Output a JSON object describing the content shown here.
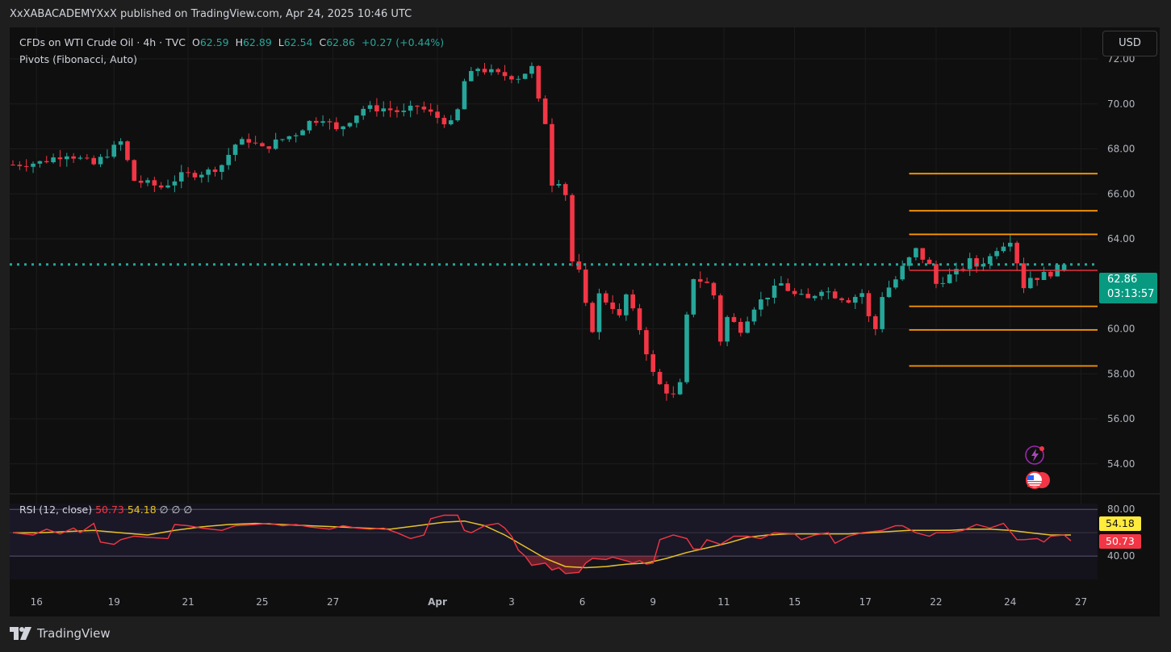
{
  "publication": "XxXABACADEMYXxX published on TradingView.com, Apr 24, 2025 10:46 UTC",
  "legend": {
    "symbol": "CFDs on WTI Crude Oil · 4h · TVC",
    "open_label": "O",
    "open": "62.59",
    "high_label": "H",
    "high": "62.89",
    "low_label": "L",
    "low": "62.54",
    "close_label": "C",
    "close": "62.86",
    "change": "+0.27 (+0.44%)",
    "indicator": "Pivots (Fibonacci, Auto)"
  },
  "currency_button": "USD",
  "last_price": "62.86",
  "countdown": "03:13:57",
  "rsi_legend": {
    "label": "RSI (12, close)",
    "value": "50.73",
    "ma_value": "54.18",
    "extras": "∅  ∅  ∅"
  },
  "rsi_tags": {
    "ma": "54.18",
    "rsi": "50.73"
  },
  "footer": {
    "brand": "TradingView"
  },
  "colors": {
    "up": "#26a69a",
    "down": "#f23645",
    "pivot": "#ff9800",
    "rsi": "#f23645",
    "rsi_ma": "#e6c229",
    "last_price_line": "#26a69a"
  },
  "chart_data": {
    "type": "candlestick",
    "ylim": [
      52.7,
      73.4
    ],
    "y_ticks": [
      "72.00",
      "70.00",
      "68.00",
      "66.00",
      "64.00",
      "60.00",
      "58.00",
      "56.00",
      "54.00"
    ],
    "x_ticks": [
      "16",
      "19",
      "21",
      "25",
      "27",
      "Apr",
      "3",
      "6",
      "9",
      "11",
      "15",
      "17",
      "22",
      "24",
      "27"
    ],
    "last_price": 62.86,
    "pivot_levels": [
      66.9,
      65.25,
      64.2,
      62.6,
      61.0,
      59.95,
      58.35
    ],
    "pivot_current": 62.6,
    "close_path": [
      [
        0,
        67.3
      ],
      [
        4,
        67.4
      ],
      [
        8,
        67.8
      ],
      [
        12,
        67.3
      ],
      [
        16,
        68.3
      ],
      [
        18,
        66.6
      ],
      [
        22,
        66.3
      ],
      [
        25,
        66.8
      ],
      [
        29,
        67.0
      ],
      [
        31,
        67.3
      ],
      [
        33,
        68.2
      ],
      [
        35,
        68.4
      ],
      [
        37,
        68.0
      ],
      [
        39,
        68.3
      ],
      [
        42,
        68.7
      ],
      [
        44,
        69.2
      ],
      [
        46,
        69.4
      ],
      [
        48,
        68.8
      ],
      [
        50,
        69.3
      ],
      [
        52,
        69.8
      ],
      [
        55,
        69.8
      ],
      [
        58,
        69.6
      ],
      [
        60,
        69.9
      ],
      [
        63,
        69.4
      ],
      [
        65,
        69.1
      ],
      [
        66,
        69.7
      ],
      [
        67,
        71.0
      ],
      [
        69,
        71.6
      ],
      [
        72,
        71.3
      ],
      [
        75,
        71.2
      ],
      [
        77,
        71.6
      ],
      [
        78,
        70.1
      ],
      [
        79,
        69.2
      ],
      [
        80,
        66.5
      ],
      [
        81,
        66.6
      ],
      [
        82,
        66.0
      ],
      [
        83,
        63.0
      ],
      [
        84,
        62.5
      ],
      [
        85,
        61.0
      ],
      [
        86,
        60.0
      ],
      [
        87,
        61.5
      ],
      [
        89,
        61.0
      ],
      [
        90,
        60.5
      ],
      [
        91,
        61.5
      ],
      [
        93,
        60.0
      ],
      [
        95,
        58.0
      ],
      [
        96,
        57.5
      ],
      [
        98,
        57.0
      ],
      [
        99,
        57.5
      ],
      [
        100,
        60.5
      ],
      [
        101,
        62.3
      ],
      [
        103,
        62.0
      ],
      [
        104,
        61.5
      ],
      [
        105,
        59.5
      ],
      [
        106,
        60.5
      ],
      [
        108,
        60.0
      ],
      [
        110,
        61.0
      ],
      [
        112,
        61.5
      ],
      [
        114,
        62.0
      ],
      [
        116,
        61.5
      ],
      [
        118,
        61.3
      ],
      [
        120,
        61.8
      ],
      [
        122,
        61.5
      ],
      [
        124,
        61.3
      ],
      [
        126,
        61.6
      ],
      [
        127,
        60.5
      ],
      [
        128,
        60.0
      ],
      [
        129,
        61.5
      ],
      [
        131,
        62.2
      ],
      [
        132,
        62.7
      ],
      [
        133,
        63.1
      ],
      [
        134,
        63.5
      ],
      [
        136,
        62.8
      ],
      [
        137,
        62.0
      ],
      [
        138,
        62.2
      ],
      [
        140,
        62.5
      ],
      [
        142,
        63.0
      ],
      [
        143,
        62.8
      ],
      [
        145,
        63.2
      ],
      [
        146,
        63.6
      ],
      [
        148,
        64.0
      ],
      [
        149,
        63.0
      ],
      [
        150,
        61.9
      ],
      [
        151,
        62.3
      ],
      [
        152,
        62.3
      ],
      [
        154,
        62.5
      ],
      [
        156,
        62.86
      ]
    ],
    "rsi_axis_ticks": [
      "80.00",
      "40.00"
    ],
    "rsi_ylim": [
      20,
      85
    ],
    "rsi_upper": 80,
    "rsi_mid": 60,
    "rsi_lower": 40,
    "rsi_series": [
      [
        0,
        60
      ],
      [
        3,
        58
      ],
      [
        5,
        63
      ],
      [
        7,
        59
      ],
      [
        9,
        64
      ],
      [
        10,
        60
      ],
      [
        12,
        68
      ],
      [
        13,
        52
      ],
      [
        15,
        50
      ],
      [
        16,
        54
      ],
      [
        18,
        57
      ],
      [
        20,
        56
      ],
      [
        23,
        55
      ],
      [
        24,
        67
      ],
      [
        26,
        66
      ],
      [
        28,
        64
      ],
      [
        31,
        62
      ],
      [
        33,
        66
      ],
      [
        36,
        67
      ],
      [
        38,
        68
      ],
      [
        40,
        66
      ],
      [
        42,
        67
      ],
      [
        44,
        65
      ],
      [
        47,
        63
      ],
      [
        49,
        66
      ],
      [
        51,
        64
      ],
      [
        53,
        63
      ],
      [
        55,
        64
      ],
      [
        57,
        60
      ],
      [
        59,
        55
      ],
      [
        61,
        58
      ],
      [
        62,
        72
      ],
      [
        64,
        75
      ],
      [
        66,
        75
      ],
      [
        67,
        62
      ],
      [
        68,
        60
      ],
      [
        70,
        66
      ],
      [
        72,
        68
      ],
      [
        73,
        64
      ],
      [
        74,
        57
      ],
      [
        75,
        45
      ],
      [
        76,
        40
      ],
      [
        77,
        32
      ],
      [
        79,
        34
      ],
      [
        80,
        28
      ],
      [
        81,
        30
      ],
      [
        82,
        25
      ],
      [
        84,
        26
      ],
      [
        85,
        34
      ],
      [
        86,
        38
      ],
      [
        88,
        37
      ],
      [
        89,
        39
      ],
      [
        91,
        36
      ],
      [
        92,
        34
      ],
      [
        93,
        36
      ],
      [
        94,
        33
      ],
      [
        95,
        34
      ],
      [
        96,
        54
      ],
      [
        98,
        58
      ],
      [
        100,
        55
      ],
      [
        101,
        46
      ],
      [
        102,
        46
      ],
      [
        103,
        54
      ],
      [
        105,
        50
      ],
      [
        107,
        57
      ],
      [
        109,
        57
      ],
      [
        111,
        55
      ],
      [
        113,
        60
      ],
      [
        116,
        59
      ],
      [
        117,
        54
      ],
      [
        119,
        58
      ],
      [
        121,
        60
      ],
      [
        122,
        51
      ],
      [
        124,
        57
      ],
      [
        126,
        60
      ],
      [
        129,
        62
      ],
      [
        131,
        66
      ],
      [
        132,
        66
      ],
      [
        134,
        60
      ],
      [
        136,
        57
      ],
      [
        137,
        60
      ],
      [
        139,
        60
      ],
      [
        141,
        62
      ],
      [
        143,
        67
      ],
      [
        145,
        64
      ],
      [
        147,
        68
      ],
      [
        149,
        54
      ],
      [
        150,
        54
      ],
      [
        152,
        55
      ],
      [
        153,
        52
      ],
      [
        154,
        57
      ],
      [
        156,
        58
      ],
      [
        157,
        53
      ]
    ],
    "rsi_ma_series": [
      [
        0,
        60
      ],
      [
        4,
        60
      ],
      [
        8,
        61
      ],
      [
        12,
        62
      ],
      [
        16,
        60
      ],
      [
        20,
        58
      ],
      [
        24,
        62
      ],
      [
        28,
        65
      ],
      [
        32,
        67
      ],
      [
        36,
        68
      ],
      [
        40,
        67
      ],
      [
        44,
        66
      ],
      [
        48,
        65
      ],
      [
        52,
        64
      ],
      [
        56,
        63
      ],
      [
        60,
        66
      ],
      [
        64,
        69
      ],
      [
        67,
        70
      ],
      [
        70,
        66
      ],
      [
        73,
        58
      ],
      [
        76,
        48
      ],
      [
        79,
        38
      ],
      [
        82,
        31
      ],
      [
        85,
        30
      ],
      [
        88,
        31
      ],
      [
        91,
        33
      ],
      [
        94,
        34
      ],
      [
        97,
        38
      ],
      [
        100,
        43
      ],
      [
        103,
        47
      ],
      [
        106,
        51
      ],
      [
        109,
        56
      ],
      [
        112,
        58
      ],
      [
        115,
        59
      ],
      [
        118,
        59
      ],
      [
        121,
        59
      ],
      [
        124,
        59
      ],
      [
        127,
        60
      ],
      [
        130,
        61
      ],
      [
        133,
        62
      ],
      [
        136,
        62
      ],
      [
        139,
        62
      ],
      [
        142,
        63
      ],
      [
        145,
        63
      ],
      [
        148,
        62
      ],
      [
        151,
        60
      ],
      [
        154,
        58
      ],
      [
        157,
        58
      ]
    ]
  }
}
